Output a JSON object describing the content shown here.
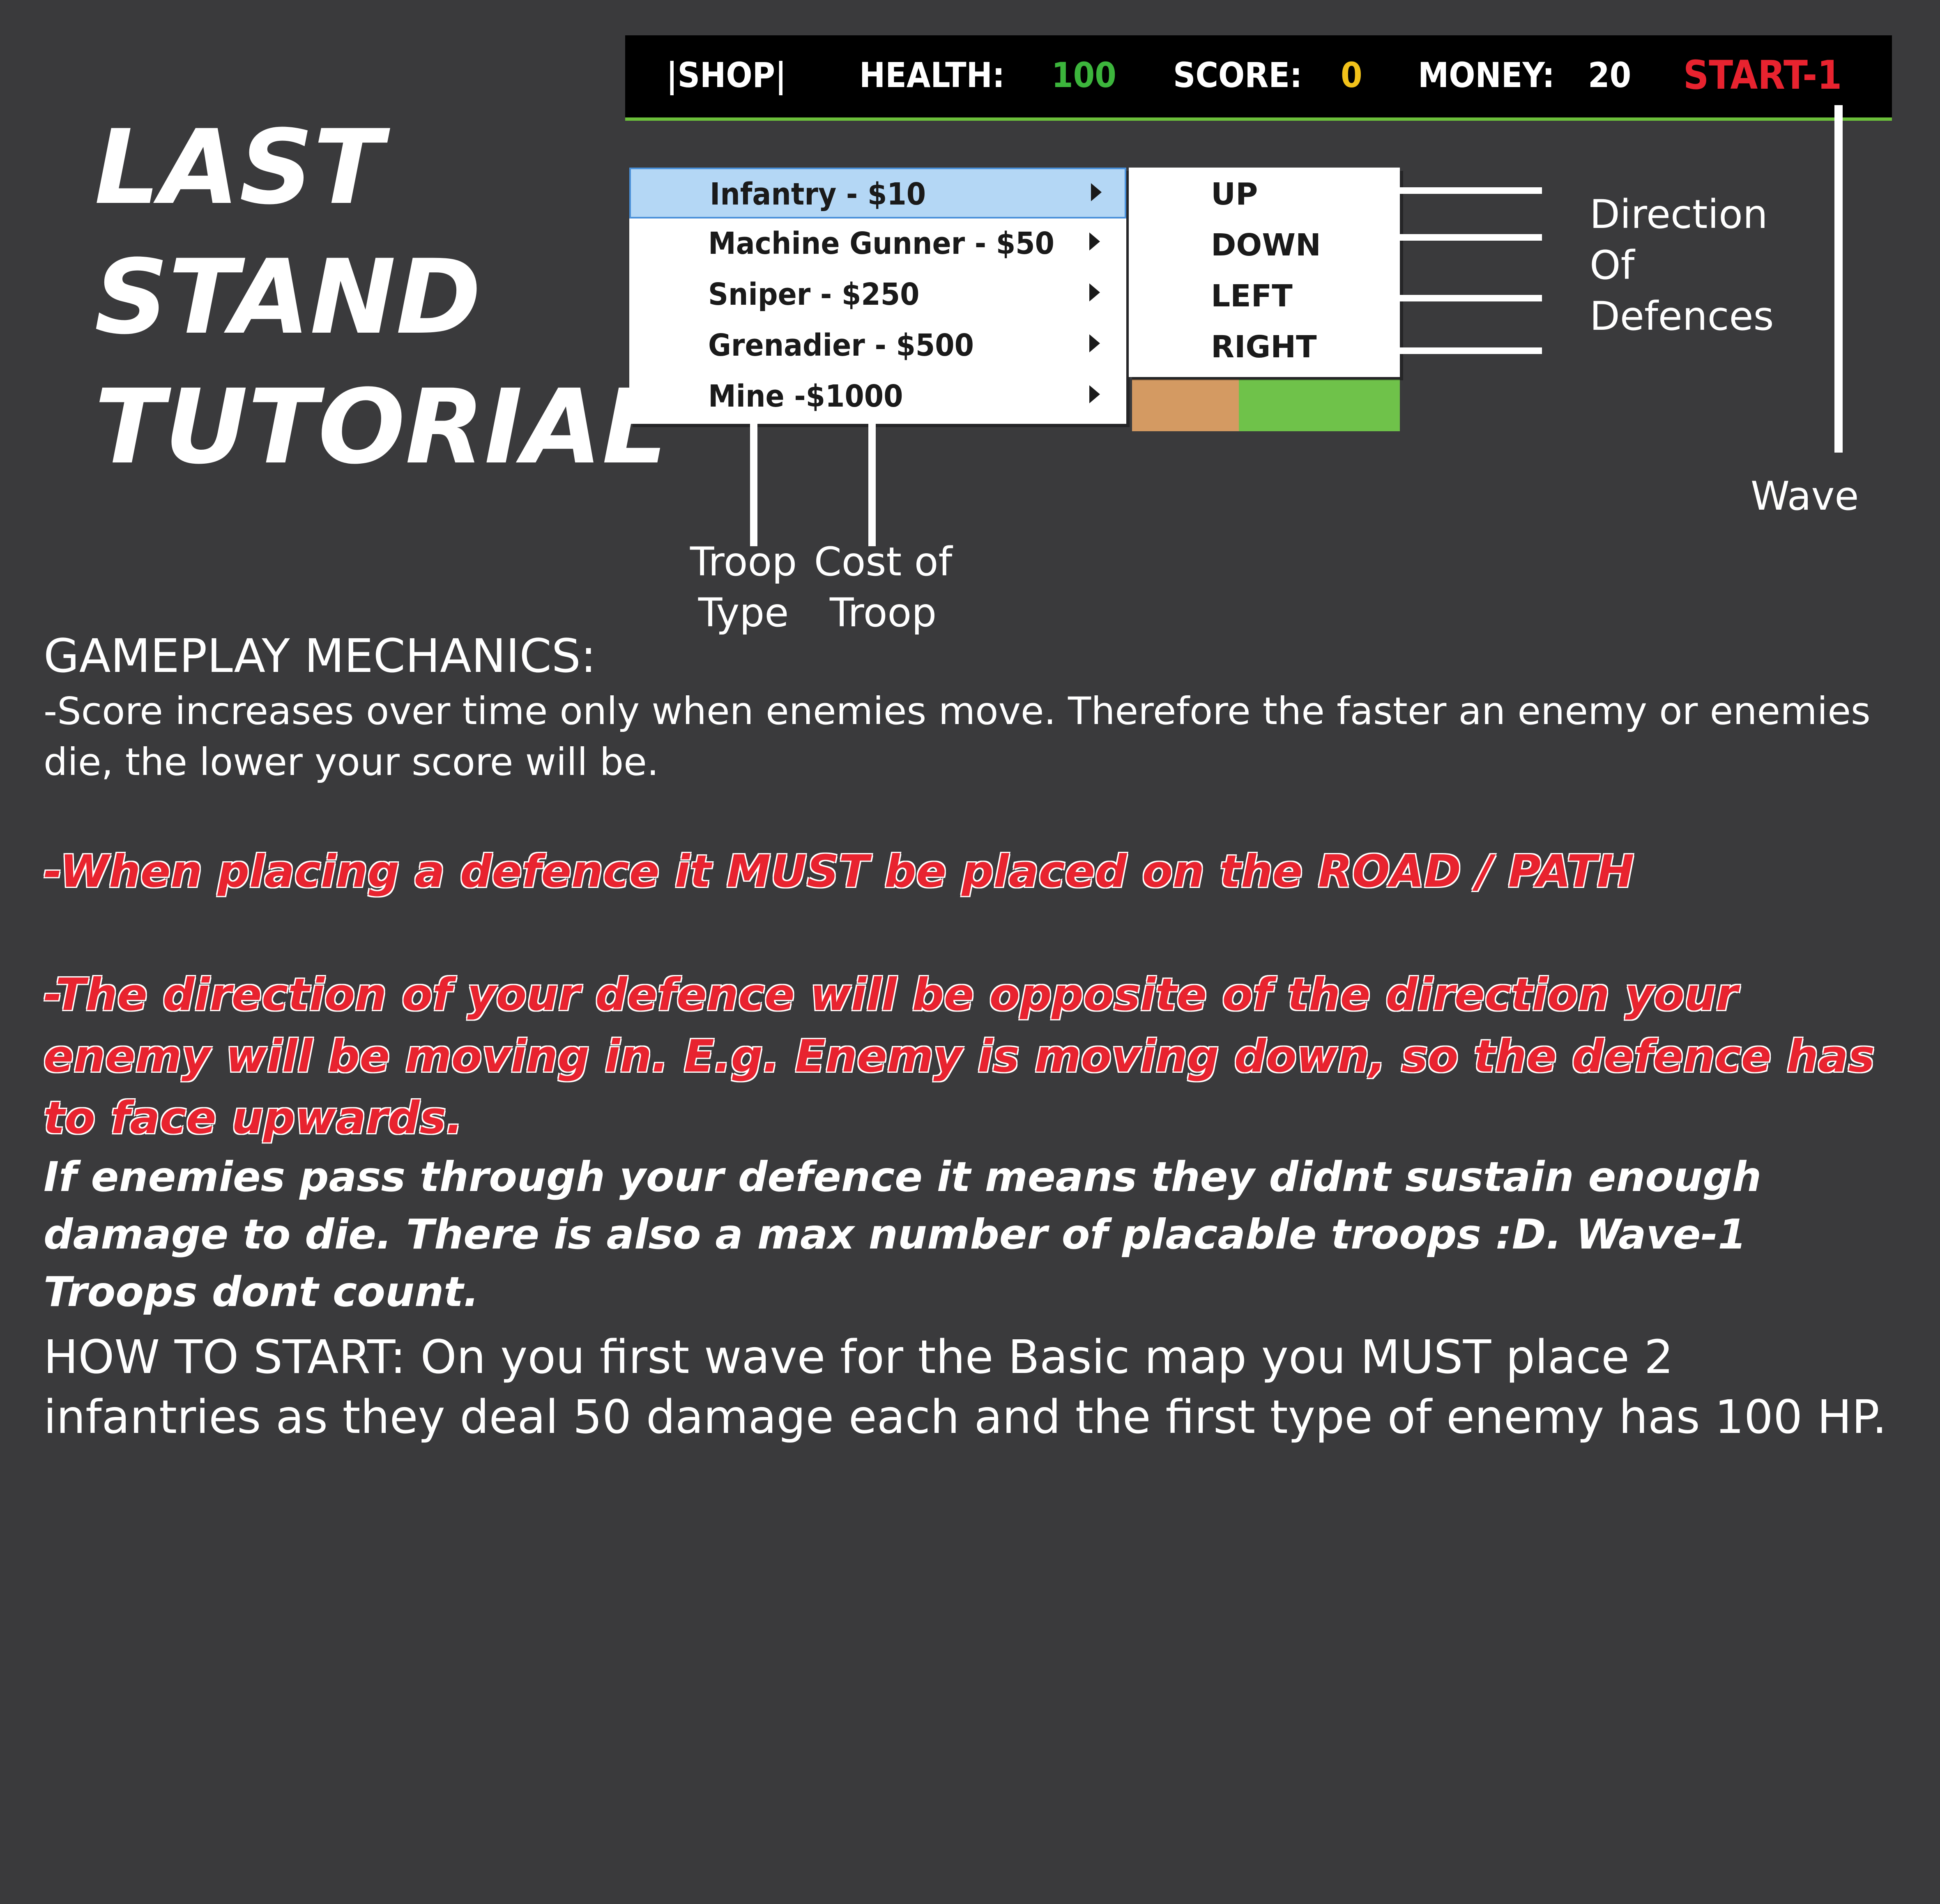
{
  "title": {
    "line1": "LAST",
    "line2": "STAND",
    "line3": "TUTORIAL"
  },
  "hud": {
    "shop": "|SHOP|",
    "health_label": "HEALTH:",
    "health_value": "100",
    "score_label": "SCORE:",
    "score_value": "0",
    "money_label": "MONEY:",
    "money_value": "20",
    "start": "START-1",
    "colors": {
      "health": "#3cb53c",
      "score": "#f2c21a",
      "start": "#e8232f",
      "border": "#6bbf3a"
    }
  },
  "shop_menu": {
    "items": [
      {
        "label": "Infantry - $10",
        "selected": true
      },
      {
        "label": "Machine Gunner - $50"
      },
      {
        "label": "Sniper - $250"
      },
      {
        "label": "Grenadier - $500"
      },
      {
        "label": "Mine -$1000"
      }
    ],
    "submenu": [
      "UP",
      "DOWN",
      "LEFT",
      "RIGHT"
    ]
  },
  "annotations": {
    "direction": [
      "Direction",
      "Of",
      "Defences"
    ],
    "wave": "Wave",
    "troop_type": [
      "Troop",
      "Type"
    ],
    "cost_of_troop": [
      "Cost of",
      "Troop"
    ]
  },
  "content": {
    "mechanics_heading": "GAMEPLAY MECHANICS:",
    "score_note": "-Score increases over time only when enemies move. Therefore the faster an enemy or enemies die, the lower your score will be.",
    "placement_rule": "-When placing a defence it MUST be placed on the ROAD / PATH",
    "direction_rule": "-The direction of your defence will be opposite of the direction your enemy will be moving in. E.g. Enemy is moving down, so the defence has to face upwards.",
    "pass_through_note": "If enemies pass through your defence it means they didnt sustain enough damage to die. There is also a max number of placable troops :D. Wave-1 Troops dont count.",
    "how_to_start": "HOW TO START: On you first wave for the Basic map you MUST place 2 infantries as they deal 50 damage each and the first type of enemy has 100 HP."
  }
}
